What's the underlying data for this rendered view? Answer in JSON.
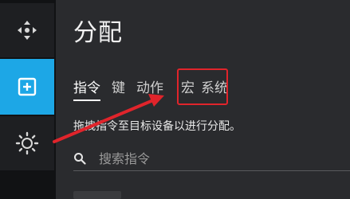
{
  "rail": {
    "items": [
      {
        "icon": "move-icon"
      },
      {
        "icon": "add-icon",
        "accent": "#1da7e6"
      },
      {
        "icon": "gear-icon"
      }
    ]
  },
  "panel": {
    "title": "分配",
    "tabs": [
      {
        "label": "指令",
        "active": true
      },
      {
        "label": "键"
      },
      {
        "label": "动作"
      },
      {
        "label": "宏"
      },
      {
        "label": "系统"
      }
    ],
    "hint": "拖拽指令至目标设备以进行分配。",
    "search": {
      "placeholder": "搜索指令",
      "value": ""
    }
  },
  "annotations": {
    "highlight_color": "#e0242b",
    "highlighted_tab": "宏"
  }
}
